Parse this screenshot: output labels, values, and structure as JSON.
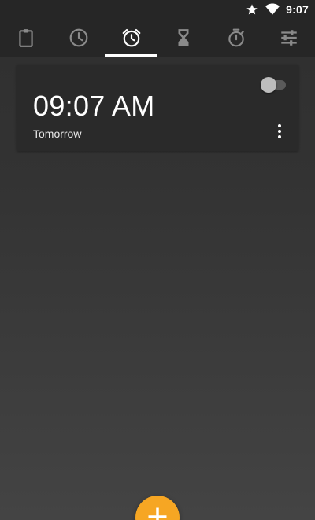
{
  "status_bar": {
    "time": "9:07",
    "icons": [
      "star-icon",
      "wifi-icon"
    ]
  },
  "tabs": [
    {
      "name": "clipboard-icon",
      "selected": false
    },
    {
      "name": "clock-icon",
      "selected": false
    },
    {
      "name": "alarm-clock-icon",
      "selected": true
    },
    {
      "name": "hourglass-icon",
      "selected": false
    },
    {
      "name": "stopwatch-icon",
      "selected": false
    },
    {
      "name": "sliders-icon",
      "selected": false
    }
  ],
  "alarm": {
    "time": "09:07 AM",
    "day": "Tomorrow",
    "enabled": false
  },
  "fab": {
    "icon": "plus-icon"
  },
  "colors": {
    "background": "#333333",
    "tabbar": "#262626",
    "card": "#2a2a2a",
    "icon_inactive": "#8a8a8a",
    "icon_active": "#ffffff",
    "accent": "#f6a623"
  }
}
